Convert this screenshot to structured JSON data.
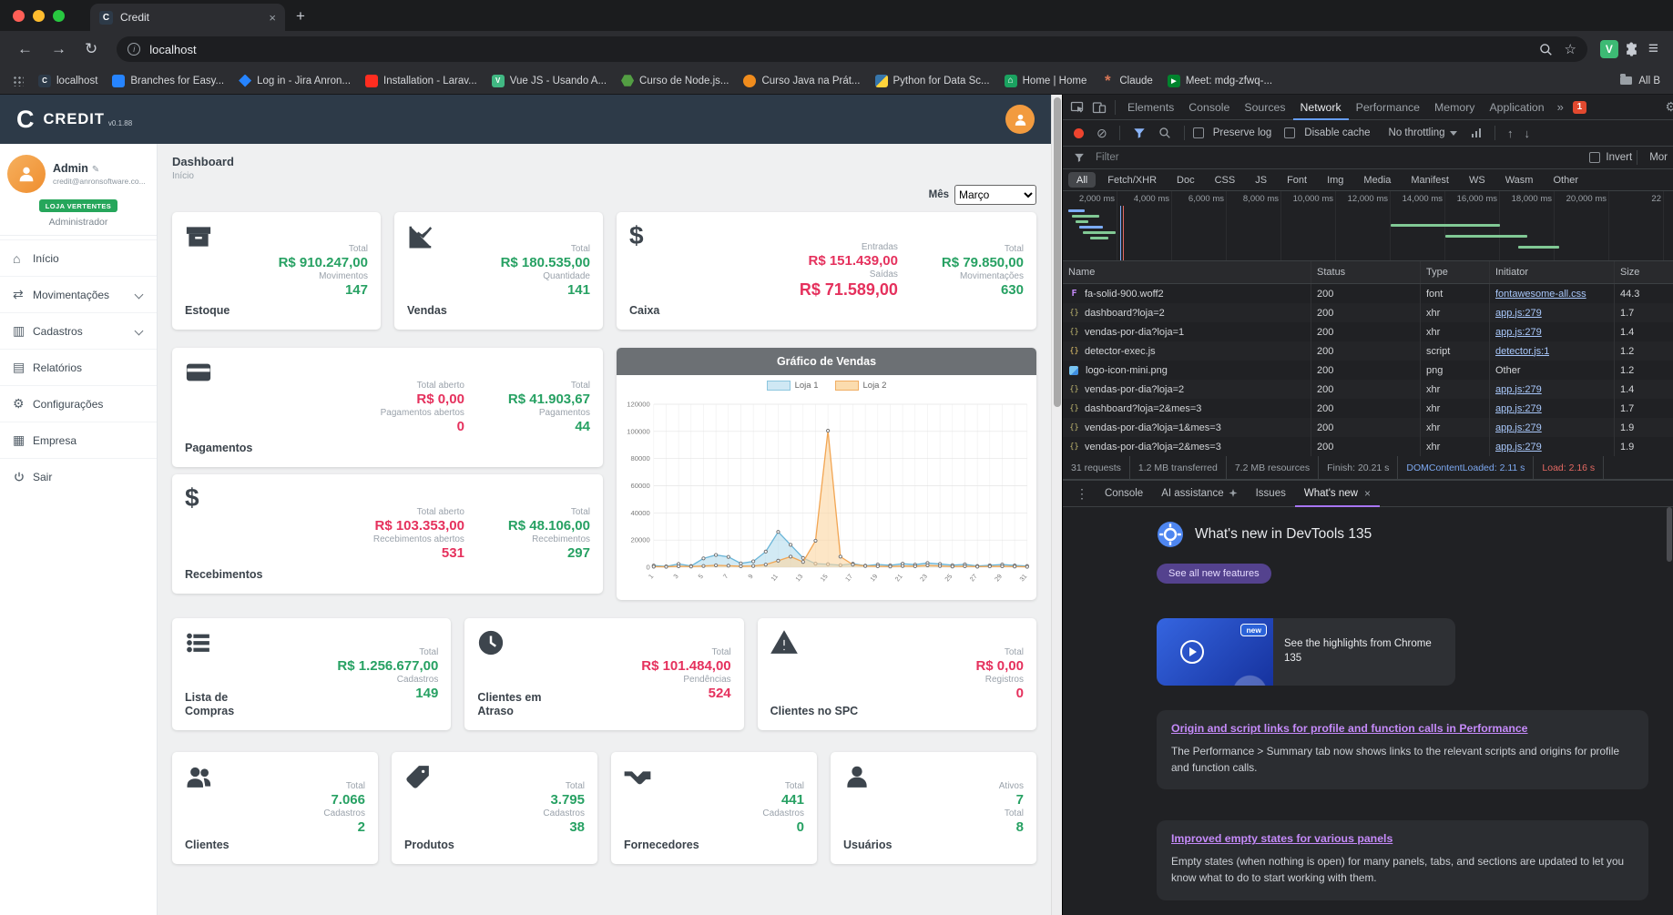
{
  "colors": {
    "green": "#27a163",
    "red": "#e5315d",
    "navy_header": "#2d3a48",
    "badge_green": "#26a65b",
    "devtools_bg": "#202124",
    "devtools_accent_blue": "#669df6",
    "devtools_accent_purple": "#a876f5",
    "record_red": "#ee442e",
    "chart_loja1": "#8cc6de",
    "chart_loja2": "#f0ad62"
  },
  "browser": {
    "tab_title": "Credit",
    "url": "localhost",
    "bookmarks": [
      {
        "label": "localhost",
        "icon": "credit-favicon"
      },
      {
        "label": "Branches for Easy...",
        "icon": "bitbucket-favicon"
      },
      {
        "label": "Log in - Jira Anron...",
        "icon": "jira-favicon"
      },
      {
        "label": "Installation - Larav...",
        "icon": "laravel-favicon"
      },
      {
        "label": "Vue JS - Usando A...",
        "icon": "vue-favicon"
      },
      {
        "label": "Curso de Node.js...",
        "icon": "node-favicon"
      },
      {
        "label": "Curso Java na Prát...",
        "icon": "java-favicon"
      },
      {
        "label": "Python for Data Sc...",
        "icon": "python-favicon"
      },
      {
        "label": "Home | Home",
        "icon": "home-favicon"
      },
      {
        "label": "Claude",
        "icon": "claude-favicon"
      },
      {
        "label": "Meet: mdg-zfwq-...",
        "icon": "meet-favicon"
      }
    ],
    "all_bookmarks_label": "All B"
  },
  "app": {
    "brand": {
      "logo_letter": "C",
      "name": "CREDIT",
      "version": "v0.1.88"
    },
    "user": {
      "name": "Admin",
      "email": "credit@anronsoftware.co...",
      "badge": "LOJA VERTENTES",
      "role": "Administrador"
    },
    "nav": [
      {
        "label": "Início"
      },
      {
        "label": "Movimentações"
      },
      {
        "label": "Cadastros"
      },
      {
        "label": "Relatórios"
      },
      {
        "label": "Configurações"
      },
      {
        "label": "Empresa"
      },
      {
        "label": "Sair"
      }
    ],
    "page": {
      "title": "Dashboard",
      "subtitle": "Início",
      "month_label": "Mês",
      "month_value": "Março"
    },
    "cards": {
      "estoque": {
        "title": "Estoque",
        "l1": "Total",
        "v1": "R$ 910.247,00",
        "l2": "Movimentos",
        "v2": "147"
      },
      "vendas": {
        "title": "Vendas",
        "l1": "Total",
        "v1": "R$ 180.535,00",
        "l2": "Quantidade",
        "v2": "141"
      },
      "caixa": {
        "title": "Caixa",
        "l1": "Entradas",
        "v1": "R$ 151.439,00",
        "l2": "Saídas",
        "v2": "R$ 71.589,00",
        "l3": "Total",
        "v3": "R$ 79.850,00",
        "l4": "Movimentações",
        "v4": "630"
      },
      "pagamentos": {
        "title": "Pagamentos",
        "l1": "Total aberto",
        "v1": "R$ 0,00",
        "l2": "Pagamentos abertos",
        "v2": "0",
        "l3": "Total",
        "v3": "R$ 41.903,67",
        "l4": "Pagamentos",
        "v4": "44"
      },
      "recebimentos": {
        "title": "Recebimentos",
        "l1": "Total aberto",
        "v1": "R$ 103.353,00",
        "l2": "Recebimentos abertos",
        "v2": "531",
        "l3": "Total",
        "v3": "R$ 48.106,00",
        "l4": "Recebimentos",
        "v4": "297"
      },
      "grafico": {
        "title": "Gráfico de Vendas"
      },
      "lista_compras": {
        "title": "Lista de Compras",
        "l1": "Total",
        "v1": "R$ 1.256.677,00",
        "l2": "Cadastros",
        "v2": "149"
      },
      "clientes_atraso": {
        "title": "Clientes em Atraso",
        "l1": "Total",
        "v1": "R$ 101.484,00",
        "l2": "Pendências",
        "v2": "524"
      },
      "clientes_spc": {
        "title": "Clientes no SPC",
        "l1": "Total",
        "v1": "R$ 0,00",
        "l2": "Registros",
        "v2": "0"
      },
      "clientes": {
        "title": "Clientes",
        "l1": "Total",
        "v1": "7.066",
        "l2": "Cadastros",
        "v2": "2"
      },
      "produtos": {
        "title": "Produtos",
        "l1": "Total",
        "v1": "3.795",
        "l2": "Cadastros",
        "v2": "38"
      },
      "fornecedores": {
        "title": "Fornecedores",
        "l1": "Total",
        "v1": "441",
        "l2": "Cadastros",
        "v2": "0"
      },
      "usuarios": {
        "title": "Usuários",
        "l1": "Ativos",
        "v1": "7",
        "l2": "Total",
        "v2": "8"
      }
    }
  },
  "chart_data": {
    "type": "area",
    "title": "Gráfico de Vendas",
    "x": [
      1,
      2,
      3,
      4,
      5,
      6,
      7,
      8,
      9,
      10,
      11,
      12,
      13,
      14,
      15,
      16,
      17,
      18,
      19,
      20,
      21,
      22,
      23,
      24,
      25,
      26,
      27,
      28,
      29,
      30,
      31
    ],
    "xlabel": "",
    "ylabel": "",
    "ylim": [
      0,
      120000
    ],
    "ytick": 20000,
    "grid": true,
    "legend_position": "top",
    "series": [
      {
        "name": "Loja 1",
        "fill": "rgba(173,216,235,0.55)",
        "stroke": "#6ab5d8",
        "values": [
          1200,
          600,
          2400,
          900,
          6500,
          9000,
          7600,
          2800,
          4300,
          11500,
          26000,
          16500,
          6800,
          2600,
          2200,
          1500,
          2600,
          1100,
          2000,
          1400,
          2600,
          1900,
          3100,
          2400,
          1500,
          2100,
          900,
          1400,
          2000,
          1300,
          900
        ]
      },
      {
        "name": "Loja 2",
        "fill": "rgba(252,213,160,0.6)",
        "stroke": "#f2a654",
        "values": [
          400,
          300,
          700,
          500,
          900,
          1400,
          1100,
          700,
          900,
          1900,
          4800,
          7800,
          3900,
          19500,
          100500,
          7800,
          1900,
          900,
          700,
          500,
          900,
          700,
          1400,
          900,
          500,
          700,
          400,
          600,
          700,
          500,
          300
        ]
      }
    ]
  },
  "devtools": {
    "tabs": [
      "Elements",
      "Console",
      "Sources",
      "Network",
      "Performance",
      "Memory",
      "Application"
    ],
    "selected_tab": "Network",
    "more_tabs_symbol": "»",
    "error_badge": "1",
    "net_toolbar": {
      "preserve_log": "Preserve log",
      "disable_cache": "Disable cache",
      "throttling": "No throttling"
    },
    "filter_bar": {
      "placeholder": "Filter",
      "invert_label": "Invert",
      "more_label": "Mor"
    },
    "chips": [
      "All",
      "Fetch/XHR",
      "Doc",
      "CSS",
      "JS",
      "Font",
      "Img",
      "Media",
      "Manifest",
      "WS",
      "Wasm",
      "Other"
    ],
    "selected_chip": "All",
    "timeline_ticks": [
      "2,000 ms",
      "4,000 ms",
      "6,000 ms",
      "8,000 ms",
      "10,000 ms",
      "12,000 ms",
      "14,000 ms",
      "16,000 ms",
      "18,000 ms",
      "20,000 ms",
      "22"
    ],
    "table": {
      "columns": [
        "Name",
        "Status",
        "Type",
        "Initiator",
        "Size"
      ],
      "rows": [
        {
          "name": "fa-solid-900.woff2",
          "status": "200",
          "type": "font",
          "initiator": "fontawesome-all.css",
          "size": "44.3",
          "icon": "font-file-icon"
        },
        {
          "name": "dashboard?loja=2",
          "status": "200",
          "type": "xhr",
          "initiator": "app.js:279",
          "size": "1.7",
          "icon": "xhr-file-icon"
        },
        {
          "name": "vendas-por-dia?loja=1",
          "status": "200",
          "type": "xhr",
          "initiator": "app.js:279",
          "size": "1.4",
          "icon": "xhr-file-icon"
        },
        {
          "name": "detector-exec.js",
          "status": "200",
          "type": "script",
          "initiator": "detector.js:1",
          "size": "1.2",
          "icon": "script-file-icon"
        },
        {
          "name": "logo-icon-mini.png",
          "status": "200",
          "type": "png",
          "initiator": "Other",
          "size": "1.2",
          "icon": "image-file-icon"
        },
        {
          "name": "vendas-por-dia?loja=2",
          "status": "200",
          "type": "xhr",
          "initiator": "app.js:279",
          "size": "1.4",
          "icon": "xhr-file-icon"
        },
        {
          "name": "dashboard?loja=2&mes=3",
          "status": "200",
          "type": "xhr",
          "initiator": "app.js:279",
          "size": "1.7",
          "icon": "xhr-file-icon"
        },
        {
          "name": "vendas-por-dia?loja=1&mes=3",
          "status": "200",
          "type": "xhr",
          "initiator": "app.js:279",
          "size": "1.9",
          "icon": "xhr-file-icon"
        },
        {
          "name": "vendas-por-dia?loja=2&mes=3",
          "status": "200",
          "type": "xhr",
          "initiator": "app.js:279",
          "size": "1.9",
          "icon": "xhr-file-icon"
        }
      ]
    },
    "summary": {
      "requests": "31 requests",
      "transferred": "1.2 MB transferred",
      "resources": "7.2 MB resources",
      "finish": "Finish: 20.21 s",
      "dcl": "DOMContentLoaded: 2.11 s",
      "load": "Load: 2.16 s"
    },
    "drawer_tabs": [
      "Console",
      "AI assistance",
      "Issues",
      "What's new"
    ],
    "drawer_selected": "What's new",
    "whats_new": {
      "title": "What's new in DevTools 135",
      "see_all_button": "See all new features",
      "badge": "new",
      "highlight": "See the highlights from Chrome 135",
      "sections": [
        {
          "heading": "Origin and script links for profile and function calls in Performance",
          "body": "The Performance > Summary tab now shows links to the relevant scripts and origins for profile and function calls."
        },
        {
          "heading": "Improved empty states for various panels",
          "body": "Empty states (when nothing is open) for many panels, tabs, and sections are updated to let you know what to do to start working with them."
        }
      ]
    }
  }
}
